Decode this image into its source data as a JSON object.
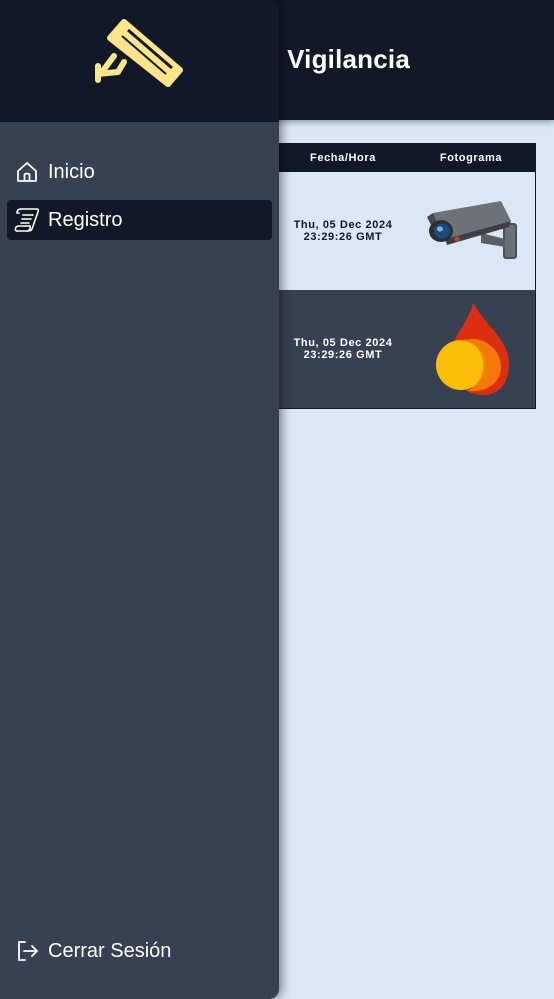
{
  "header": {
    "title_visible": "e Vigilancia"
  },
  "table": {
    "columns": [
      "Fecha/Hora",
      "Fotograma"
    ],
    "rows": [
      {
        "date_line1": "Thu, 05 Dec 2024",
        "date_line2": "23:29:26 GMT",
        "frame_icon": "security-camera-image"
      },
      {
        "date_line1": "Thu, 05 Dec 2024",
        "date_line2": "23:29:26 GMT",
        "frame_icon": "fire-image"
      }
    ]
  },
  "drawer": {
    "logo_icon": "security-camera-icon",
    "logo_color": "#fde68a",
    "items": [
      {
        "label": "Inicio",
        "icon": "home-icon",
        "active": false
      },
      {
        "label": "Registro",
        "icon": "scroll-icon",
        "active": true
      }
    ],
    "logout_label": "Cerrar Sesión",
    "logout_icon": "logout-icon"
  },
  "colors": {
    "dark_navy": "#111827",
    "slate": "#374151",
    "light_bg": "#dbe6f7"
  }
}
